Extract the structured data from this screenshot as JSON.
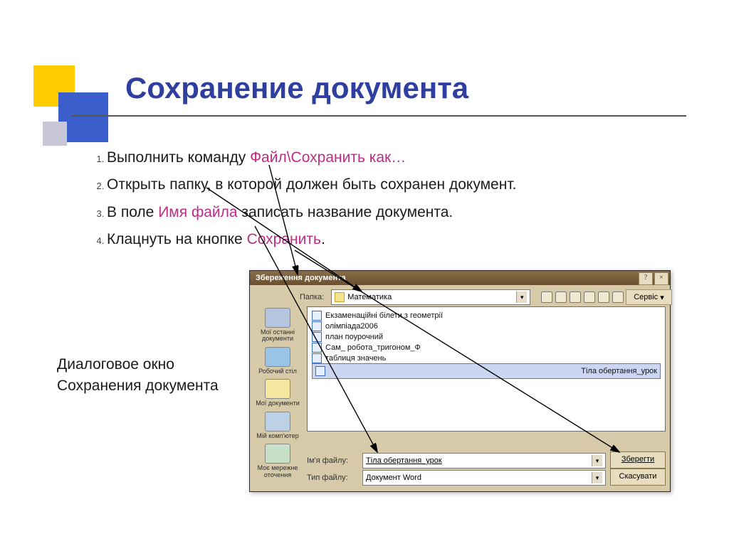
{
  "title": "Сохранение документа",
  "steps": [
    {
      "pre": "Выполнить команду ",
      "accent": "Файл\\Сохранить как…",
      "post": ""
    },
    {
      "pre": "Открыть папку, в которой должен быть сохранен документ.",
      "accent": "",
      "post": ""
    },
    {
      "pre": "В поле ",
      "accent": "Имя файла",
      "post": " записать название документа."
    },
    {
      "pre": "Клацнуть на кнопке ",
      "accent": "Сохранить",
      "post": "."
    }
  ],
  "caption_line1": "Диалоговое окно",
  "caption_line2": "Сохранения документа",
  "dialog": {
    "title": "Збереження документа",
    "folder_label": "Папка:",
    "folder_value": "Математика",
    "service_label": "Сервіс",
    "files": [
      "Екзаменаційні білети з геометрії",
      "олімпіада2006",
      "план поурочний",
      "Сам_ робота_тригоном_Ф",
      "таблиця значень",
      "Тіла обертання_урок"
    ],
    "filename_label": "Ім'я файлу:",
    "filename_value": "Тіла обертання_урок",
    "filetype_label": "Тип файлу:",
    "filetype_value": "Документ Word",
    "save_btn": "Зберегти",
    "cancel_btn": "Скасувати",
    "places": [
      "Мої останні документи",
      "Робочий стіл",
      "Мої документи",
      "Мій комп'ютер",
      "Моє мережне оточення"
    ]
  }
}
